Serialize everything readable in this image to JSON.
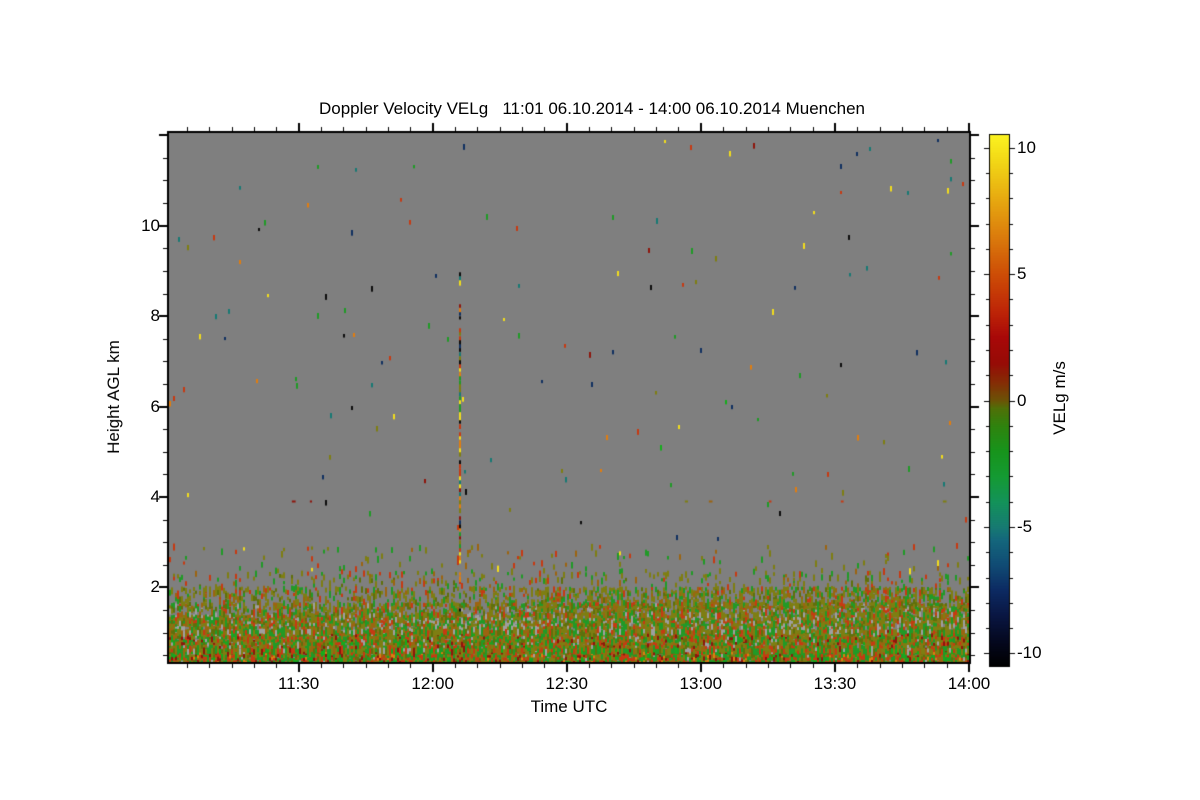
{
  "chart_data": {
    "type": "heatmap",
    "title": "Doppler Velocity VELg   11:01 06.10.2014 - 14:00 06.10.2014 Muenchen",
    "xlabel": "Time UTC",
    "ylabel": "Height AGL km",
    "station": "Muenchen",
    "time_span": "11:01 06.10.2014 - 14:00 06.10.2014",
    "x_range": [
      "11:01",
      "14:00"
    ],
    "y_range_km": [
      0.35,
      12.05
    ],
    "x_major_ticks": [
      "11:30",
      "12:00",
      "12:30",
      "13:00",
      "13:30",
      "14:00"
    ],
    "x_minor_step_min": 5,
    "y_major_ticks": [
      2,
      4,
      6,
      8,
      10
    ],
    "y_minor_step_km": 0.5,
    "no_data_color": "#7f7f7f",
    "frame_color": "#000000",
    "seed": 42,
    "colorbar": {
      "label": "VELg m/s",
      "units": "m/s",
      "range": [
        -10.5,
        10.5
      ],
      "ticks": [
        10,
        5,
        0,
        -5,
        -10
      ],
      "minor_step": 1,
      "stops": [
        [
          -10.5,
          "#000000"
        ],
        [
          -9.6,
          "#04071c"
        ],
        [
          -8.5,
          "#091642"
        ],
        [
          -7.5,
          "#0c2a62"
        ],
        [
          -6.5,
          "#104b74"
        ],
        [
          -5.5,
          "#14677c"
        ],
        [
          -5.0,
          "#167a72"
        ],
        [
          -4.0,
          "#13925a"
        ],
        [
          -3.0,
          "#149a33"
        ],
        [
          -2.0,
          "#17941c"
        ],
        [
          -1.0,
          "#2f830e"
        ],
        [
          -0.3,
          "#4f7008"
        ],
        [
          0.0,
          "#6b5406"
        ],
        [
          0.7,
          "#842e05"
        ],
        [
          1.5,
          "#970b06"
        ],
        [
          2.5,
          "#a80808"
        ],
        [
          3.5,
          "#bd2407"
        ],
        [
          5.0,
          "#cd4d06"
        ],
        [
          6.5,
          "#db7c0c"
        ],
        [
          8.0,
          "#e7aa10"
        ],
        [
          9.5,
          "#f2d816"
        ],
        [
          10.5,
          "#fbf220"
        ]
      ]
    },
    "palette": {
      "black": "#0d0d0d",
      "navy": "#113060",
      "teal": "#187a74",
      "green": "#219a27",
      "bright_green": "#15ad1c",
      "olive": "#7e7e12",
      "dark_olive": "#5f700b",
      "brown": "#9c6410",
      "dark_red": "#8e150c",
      "red": "#c63a12",
      "orange": "#df7d10",
      "yellow": "#f1dc1e",
      "gray_light": "#9f9f9f"
    },
    "features": {
      "boundary_layer_bands": [
        {
          "from": 0.35,
          "to": 0.65,
          "coverage": 1.0,
          "weights": {
            "green": 24,
            "bright_green": 7,
            "olive": 18,
            "dark_olive": 7,
            "red": 18,
            "dark_red": 9,
            "brown": 11,
            "orange": 4,
            "gray_light": 2
          }
        },
        {
          "from": 0.65,
          "to": 1.05,
          "coverage": 0.97,
          "weights": {
            "green": 24,
            "olive": 26,
            "dark_olive": 9,
            "red": 12,
            "brown": 15,
            "dark_red": 5,
            "bright_green": 4,
            "gray_light": 5
          }
        },
        {
          "from": 1.05,
          "to": 1.4,
          "coverage": 0.88,
          "weights": {
            "green": 22,
            "olive": 29,
            "dark_olive": 11,
            "brown": 14,
            "red": 10,
            "gray_light": 14
          }
        },
        {
          "from": 1.4,
          "to": 1.65,
          "coverage": 0.5,
          "boost": {
            "after": "12:20",
            "factor": 1.5
          },
          "weights": {
            "olive": 33,
            "green": 22,
            "dark_olive": 13,
            "brown": 13,
            "red": 11,
            "gray_light": 8
          }
        },
        {
          "from": 1.65,
          "to": 2.0,
          "coverage": 0.3,
          "boost": {
            "after": "12:20",
            "factor": 1.6
          },
          "weights": {
            "olive": 45,
            "dark_olive": 15,
            "green": 18,
            "brown": 12,
            "red": 10
          }
        },
        {
          "from": 2.0,
          "to": 2.35,
          "coverage": 0.12,
          "weights": {
            "olive": 45,
            "green": 22,
            "red": 14,
            "brown": 11,
            "dark_olive": 8
          }
        },
        {
          "from": 2.35,
          "to": 2.95,
          "coverage": 0.03,
          "weights": {
            "olive": 38,
            "green": 26,
            "red": 20,
            "brown": 10,
            "yellow": 6
          }
        }
      ],
      "sparse_noise": {
        "count": 135,
        "from_km": 2.9,
        "to_km": 11.95,
        "weights": {
          "teal": 14,
          "navy": 12,
          "green": 14,
          "olive": 9,
          "orange": 10,
          "yellow": 11,
          "red": 12,
          "black": 10,
          "dark_red": 4,
          "bright_green": 4
        }
      },
      "dash_rows": [
        {
          "km": 3.9,
          "from": "11:05",
          "to": "14:00",
          "coverage": 0.05,
          "weights": {
            "red": 30,
            "brown": 24,
            "olive": 22,
            "green": 16,
            "dark_red": 8
          }
        },
        {
          "km": 1.57,
          "from": "12:22",
          "to": "14:00",
          "coverage": 0.55,
          "weights": {
            "olive": 50,
            "dark_olive": 30,
            "brown": 20
          }
        }
      ],
      "vertical_streak": {
        "time": "12:06",
        "from_km": 2.2,
        "to_km": 9.5,
        "sparse_above_km": 8.3,
        "dense_low_km": 2.95,
        "weights": {
          "black": 11,
          "navy": 8,
          "teal": 12,
          "green": 15,
          "olive": 8,
          "red": 14,
          "dark_red": 6,
          "orange": 15,
          "yellow": 11
        },
        "low_weights": {
          "orange": 48,
          "yellow": 26,
          "red": 18,
          "green": 8
        },
        "tail": {
          "from_km": 1.25,
          "to_km": 1.6,
          "color": "black",
          "coverage": 0.6
        }
      }
    }
  }
}
